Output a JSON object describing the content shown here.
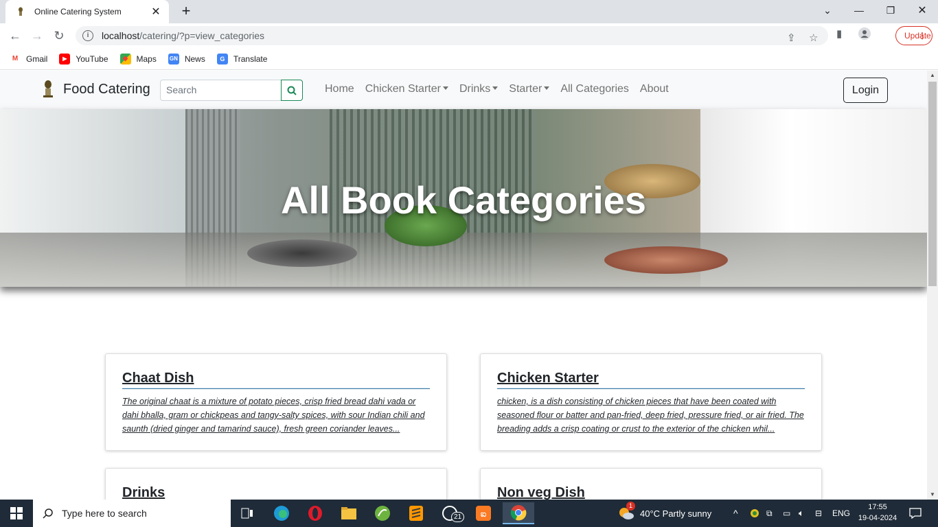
{
  "browser": {
    "tab_title": "Online Catering System",
    "url_host": "localhost",
    "url_path": "/catering/?p=view_categories",
    "update_label": "Update",
    "bookmarks": [
      {
        "label": "Gmail",
        "icon": "gmail-icon",
        "color": "#ea4335"
      },
      {
        "label": "YouTube",
        "icon": "youtube-icon",
        "color": "#ff0000"
      },
      {
        "label": "Maps",
        "icon": "maps-icon",
        "color": "#34a853"
      },
      {
        "label": "News",
        "icon": "news-icon",
        "color": "#4285f4"
      },
      {
        "label": "Translate",
        "icon": "translate-icon",
        "color": "#4285f4"
      }
    ]
  },
  "site": {
    "brand": "Food Catering",
    "search_placeholder": "Search",
    "nav": [
      {
        "label": "Home",
        "dropdown": false
      },
      {
        "label": "Chicken Starter",
        "dropdown": true
      },
      {
        "label": "Drinks",
        "dropdown": true
      },
      {
        "label": "Starter",
        "dropdown": true
      },
      {
        "label": "All Categories",
        "dropdown": false
      },
      {
        "label": "About",
        "dropdown": false
      }
    ],
    "login_label": "Login",
    "hero_title": "All Book Categories"
  },
  "categories": [
    {
      "title": "Chaat Dish",
      "description": "The original chaat is a mixture of potato pieces, crisp fried bread dahi vada or dahi bhalla, gram or chickpeas and tangy-salty spices, with sour Indian chili and saunth (dried ginger and tamarind sauce), fresh green coriander leaves..."
    },
    {
      "title": "Chicken Starter",
      "description": "chicken, is a dish consisting of chicken pieces that have been coated with seasoned flour or batter and pan-fried, deep fried, pressure fried, or air fried. The breading adds a crisp coating or crust to the exterior of the chicken whil..."
    },
    {
      "title": "Drinks",
      "description": ""
    },
    {
      "title": "Non veg Dish",
      "description": ""
    }
  ],
  "taskbar": {
    "search_placeholder": "Type here to search",
    "whatsapp_badge": "21",
    "weather_badge": "1",
    "weather": "40°C  Partly sunny",
    "language": "ENG",
    "time": "17:55",
    "date": "19-04-2024"
  }
}
